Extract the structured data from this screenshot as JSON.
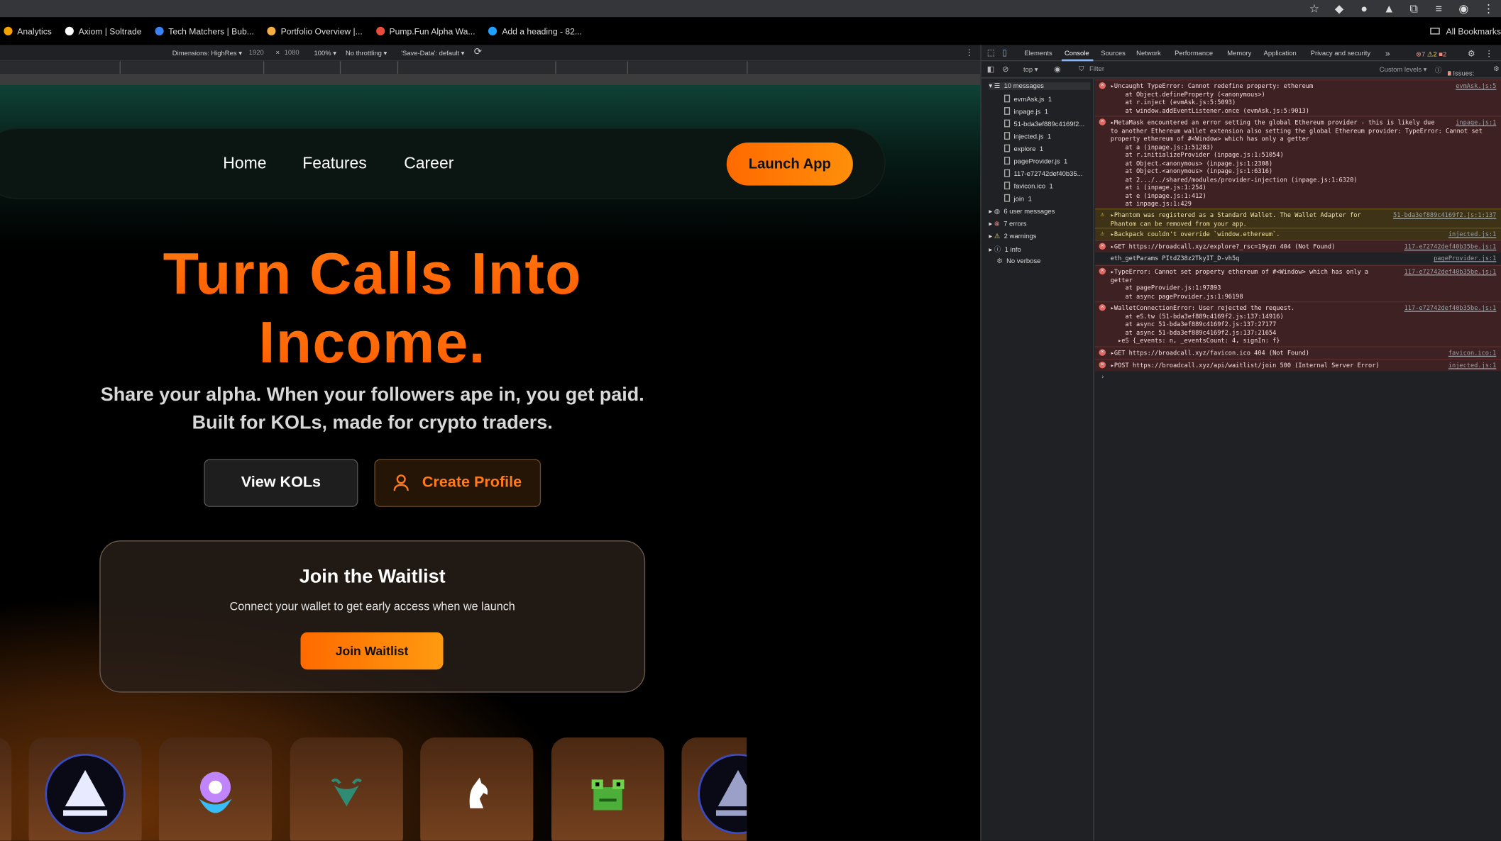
{
  "browser": {
    "bookmarks": [
      {
        "label": "Analytics",
        "icon": "bar-chart-icon",
        "color": "#f4a300"
      },
      {
        "label": "Axiom | Soltrade",
        "icon": "axiom-icon",
        "color": "#ffffff"
      },
      {
        "label": "Tech Matchers | Bub...",
        "icon": "bubble-icon",
        "color": "#3b82f6"
      },
      {
        "label": "Portfolio Overview |...",
        "icon": "portfolio-icon",
        "color": "#f5b041"
      },
      {
        "label": "Pump.Fun Alpha Wa...",
        "icon": "pill-icon",
        "color": "#e74c3c"
      },
      {
        "label": "Add a heading - 82...",
        "icon": "canva-icon",
        "color": "#1fa2ff"
      }
    ],
    "all_bookmarks": "All Bookmarks"
  },
  "devbar": {
    "dimensions": "Dimensions: HighRes ▾",
    "width": "1920",
    "times": "×",
    "height": "1080",
    "zoom": "100% ▾",
    "throttling": "No throttling ▾",
    "save_data": "'Save-Data': default ▾"
  },
  "site": {
    "nav": [
      "Home",
      "Features",
      "Career"
    ],
    "launch_button": "Launch App",
    "headline_line1": "Turn Calls Into",
    "headline_line2": "Income.",
    "subtitle": "Share your alpha. When your followers ape in, you get paid. Built for KOLs, made for crypto traders.",
    "view_kols": "View KOLs",
    "create_profile": "Create Profile",
    "waitlist_title": "Join the Waitlist",
    "waitlist_subtitle": "Connect your wallet to get early access when we launch",
    "waitlist_button": "Join Waitlist",
    "accent_color": "#ff6a00"
  },
  "devtools": {
    "tabs": [
      "Elements",
      "Console",
      "Sources",
      "Network",
      "Performance",
      "Memory",
      "Application",
      "Privacy and security"
    ],
    "active_tab": "Console",
    "counts": {
      "errors": "7",
      "warnings": "2",
      "issues_badge": "2"
    },
    "context": "top ▾",
    "filter_placeholder": "Filter",
    "levels": "Custom levels ▾",
    "issues": "2 Issues:",
    "issues_count": "2",
    "sidebar": {
      "messages": "10 messages",
      "files": [
        {
          "name": "evmAsk.js",
          "count": "1"
        },
        {
          "name": "inpage.js",
          "count": "1"
        },
        {
          "name": "51-bda3ef889c4169f2...",
          "count": ""
        },
        {
          "name": "injected.js",
          "count": "1"
        },
        {
          "name": "explore",
          "count": "1"
        },
        {
          "name": "pageProvider.js",
          "count": "1"
        },
        {
          "name": "117-e72742def40b35...",
          "count": ""
        },
        {
          "name": "favicon.ico",
          "count": "1"
        },
        {
          "name": "join",
          "count": "1"
        }
      ],
      "user_messages": "6 user messages",
      "errors": "7 errors",
      "warnings": "2 warnings",
      "info": "1 info",
      "verbose": "No verbose"
    },
    "messages": [
      {
        "level": "error",
        "source": "evmAsk.js:5",
        "lines": [
          "▸Uncaught TypeError: Cannot redefine property: ethereum",
          "    at Object.defineProperty (<anonymous>)",
          "    at r.inject (evmAsk.js:5:5093)",
          "    at window.addEventListener.once (evmAsk.js:5:9013)"
        ]
      },
      {
        "level": "error",
        "source": "inpage.js:1",
        "lines": [
          "▸MetaMask encountered an error setting the global Ethereum provider - this is likely due",
          "to another Ethereum wallet extension also setting the global Ethereum provider: TypeError: Cannot set",
          "property ethereum of #<Window> which has only a getter",
          "    at a (inpage.js:1:51283)",
          "    at r.initializeProvider (inpage.js:1:51054)",
          "    at Object.<anonymous> (inpage.js:1:2308)",
          "    at Object.<anonymous> (inpage.js:1:6316)",
          "    at 2.../../shared/modules/provider-injection (inpage.js:1:6320)",
          "    at i (inpage.js:1:254)",
          "    at e (inpage.js:1:412)",
          "    at inpage.js:1:429"
        ]
      },
      {
        "level": "warn",
        "source": "51-bda3ef889c4169f2.js:1:137",
        "lines": [
          "▸Phantom was registered as a Standard Wallet. The Wallet Adapter for",
          "Phantom can be removed from your app."
        ]
      },
      {
        "level": "warn",
        "source": "injected.js:1",
        "lines": [
          "▸Backpack couldn't override `window.ethereum`."
        ]
      },
      {
        "level": "error",
        "source": "117-e72742def40b35be.js:1",
        "lines": [
          "▸GET https://broadcall.xyz/explore?_rsc=19yzn 404 (Not Found)"
        ]
      },
      {
        "level": "plain",
        "source": "pageProvider.js:1",
        "lines": [
          "eth_getParams PItdZ38z2TkyIT_D-vh5q"
        ]
      },
      {
        "level": "error",
        "source": "117-e72742def40b35be.js:1",
        "lines": [
          "▸TypeError: Cannot set property ethereum of #<Window> which has only a",
          "getter",
          "    at pageProvider.js:1:97893",
          "    at async pageProvider.js:1:96198"
        ]
      },
      {
        "level": "error",
        "source": "117-e72742def40b35be.js:1",
        "lines": [
          "▸WalletConnectionError: User rejected the request.",
          "    at eS.tw (51-bda3ef889c4169f2.js:137:14916)",
          "    at async 51-bda3ef889c4169f2.js:137:27177",
          "    at async 51-bda3ef889c4169f2.js:137:21654",
          "  ▸eS {_events: n, _eventsCount: 4, signIn: f}"
        ]
      },
      {
        "level": "error",
        "source": "favicon.ico:1",
        "lines": [
          "▸GET https://broadcall.xyz/favicon.ico 404 (Not Found)"
        ]
      },
      {
        "level": "error",
        "source": "injected.js:1",
        "lines": [
          "▸POST https://broadcall.xyz/api/waitlist/join 500 (Internal Server Error)"
        ]
      }
    ],
    "prompt": "›"
  }
}
